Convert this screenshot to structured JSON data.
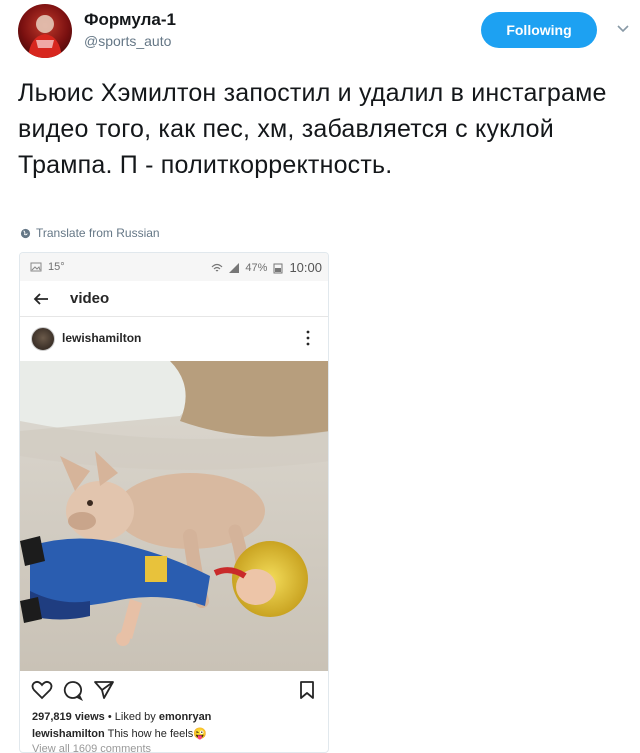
{
  "author": {
    "display_name": "Формула-1",
    "handle": "@sports_auto"
  },
  "follow_button": {
    "label": "Following"
  },
  "tweet": {
    "text": "Льюис Хэмилтон запостил и удалил в инстаграме видео того, как пес, хм, забавляется с куклой Трампа. П - политкорректность.",
    "translate_label": "Translate from Russian"
  },
  "embedded_screenshot": {
    "status_bar": {
      "temperature": "15°",
      "battery": "47%",
      "time": "10:00"
    },
    "header_title": "video",
    "post": {
      "username": "lewishamilton",
      "views": "297,819 views",
      "liked_by_prefix": "Liked by",
      "liked_by": "emonryan",
      "caption_user": "lewishamilton",
      "caption_text": "This how he feels😜",
      "comments_link": "View all 1609 comments"
    }
  },
  "colors": {
    "accent": "#1da1f2",
    "handle_gray": "#657786"
  },
  "icons": {
    "caret": "chevron-down-icon",
    "translate": "globe-icon",
    "back": "back-arrow-icon",
    "more": "more-vertical-icon",
    "like": "heart-icon",
    "comment": "comment-icon",
    "share": "send-icon",
    "save": "bookmark-icon"
  }
}
